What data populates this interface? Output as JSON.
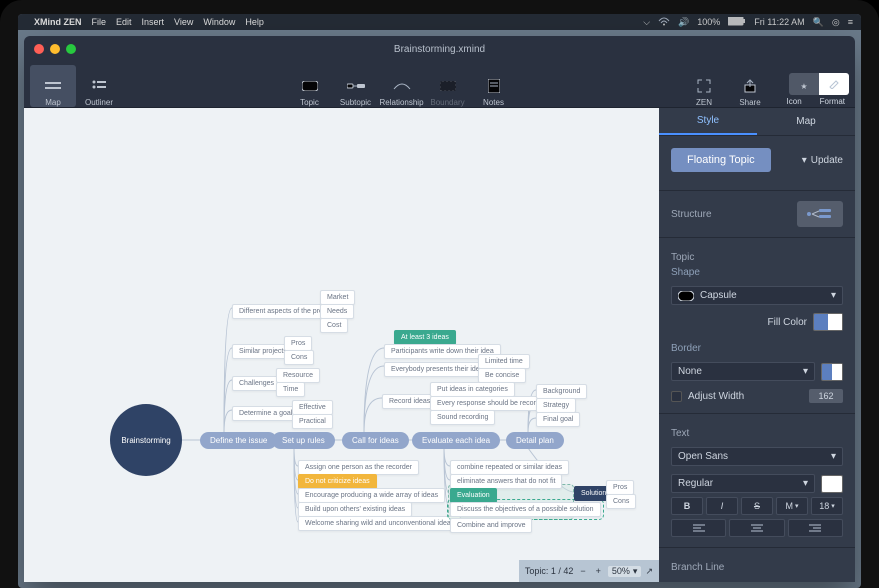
{
  "menubar": {
    "app": "XMind ZEN",
    "items": [
      "File",
      "Edit",
      "Insert",
      "View",
      "Window",
      "Help"
    ],
    "battery": "100%",
    "clock": "Fri 11:22 AM"
  },
  "window": {
    "title": "Brainstorming.xmind"
  },
  "toolbar": {
    "map": "Map",
    "outliner": "Outliner",
    "topic": "Topic",
    "subtopic": "Subtopic",
    "relationship": "Relationship",
    "boundary": "Boundary",
    "notes": "Notes",
    "zen": "ZEN",
    "share": "Share",
    "icon": "Icon",
    "format": "Format"
  },
  "status": {
    "label": "Topic: 1 / 42",
    "zoom": "50%",
    "arrow": "↗"
  },
  "panel": {
    "tabs": {
      "style": "Style",
      "map": "Map",
      "active": "style"
    },
    "float_label": "Floating Topic",
    "update": "Update",
    "structure": "Structure",
    "topic": "Topic",
    "shape": "Shape",
    "shape_val": "Capsule",
    "fill": "Fill Color",
    "border": "Border",
    "border_val": "None",
    "adjust": "Adjust Width",
    "adjust_val": "162",
    "text": "Text",
    "font": "Open Sans",
    "weight": "Regular",
    "b": "B",
    "i": "I",
    "s": "S",
    "m": "M",
    "size": "18",
    "branch": "Branch Line"
  },
  "map": {
    "root": "Brainstorming",
    "main": [
      "Define the issue",
      "Set up rules",
      "Call for ideas",
      "Evaluate each idea",
      "Detail plan"
    ],
    "define": {
      "items": [
        "Different aspects of the problem",
        "Similar projects",
        "Challenges",
        "Determine a goal"
      ],
      "aspects": [
        "Market",
        "Needs",
        "Cost"
      ],
      "similar": [
        "Pros",
        "Cons"
      ],
      "challenges": [
        "Resource",
        "Time"
      ],
      "goal": [
        "Effective",
        "Practical"
      ]
    },
    "rules": [
      "Assign one person as the recorder",
      "Do not criticize ideas",
      "Encourage producing a wide array of ideas",
      "Build upon others' existing ideas",
      "Welcome sharing wild and unconventional ideas"
    ],
    "call": {
      "tag": "At least 3 ideas",
      "items": [
        "Participants write down their idea",
        "Everybody presents their idea in turn",
        "Record ideas"
      ],
      "present": [
        "Limited time",
        "Be concise"
      ],
      "record": [
        "Put ideas in categories",
        "Every response should be recorded",
        "Sound recording"
      ]
    },
    "eval": [
      "combine repeated or similar ideas",
      "eliminate answers that do not fit",
      "Evaluation",
      "Discuss the objectives of a possible solution",
      "Combine and improve"
    ],
    "plan": {
      "items": [
        "Background",
        "Strategy",
        "Final goal",
        "Solution"
      ],
      "solution": [
        "Pros",
        "Cons"
      ]
    }
  }
}
